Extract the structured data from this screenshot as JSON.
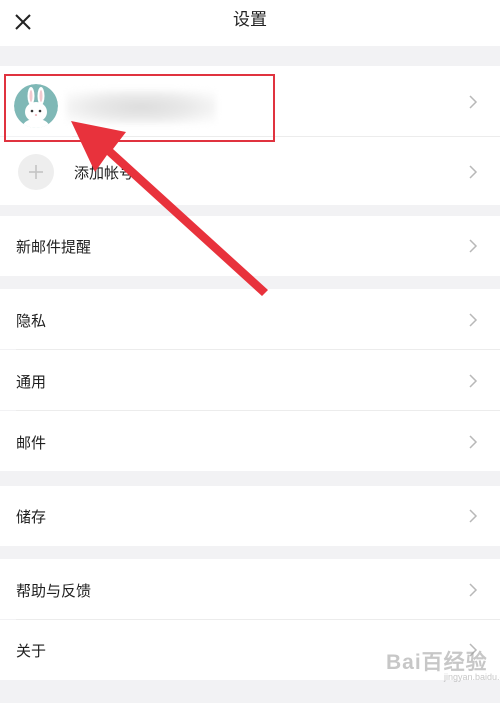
{
  "header": {
    "title": "设置",
    "close_icon": "close-icon"
  },
  "account": {
    "avatar_icon": "rabbit-avatar-icon",
    "name": ""
  },
  "add_account": {
    "label": "添加帐号",
    "icon": "plus-icon"
  },
  "settings": {
    "new_mail_alert": "新邮件提醒",
    "privacy": "隐私",
    "general": "通用",
    "mail": "邮件",
    "storage": "储存",
    "help_feedback": "帮助与反馈",
    "about": "关于"
  },
  "watermark": {
    "main": "Bai百经验",
    "sub": "jingyan.baidu.com"
  },
  "colors": {
    "background": "#f2f2f4",
    "row": "#ffffff",
    "highlight": "#e0333f",
    "arrow": "#e8323c",
    "avatar_bg": "#7fb8b6"
  }
}
